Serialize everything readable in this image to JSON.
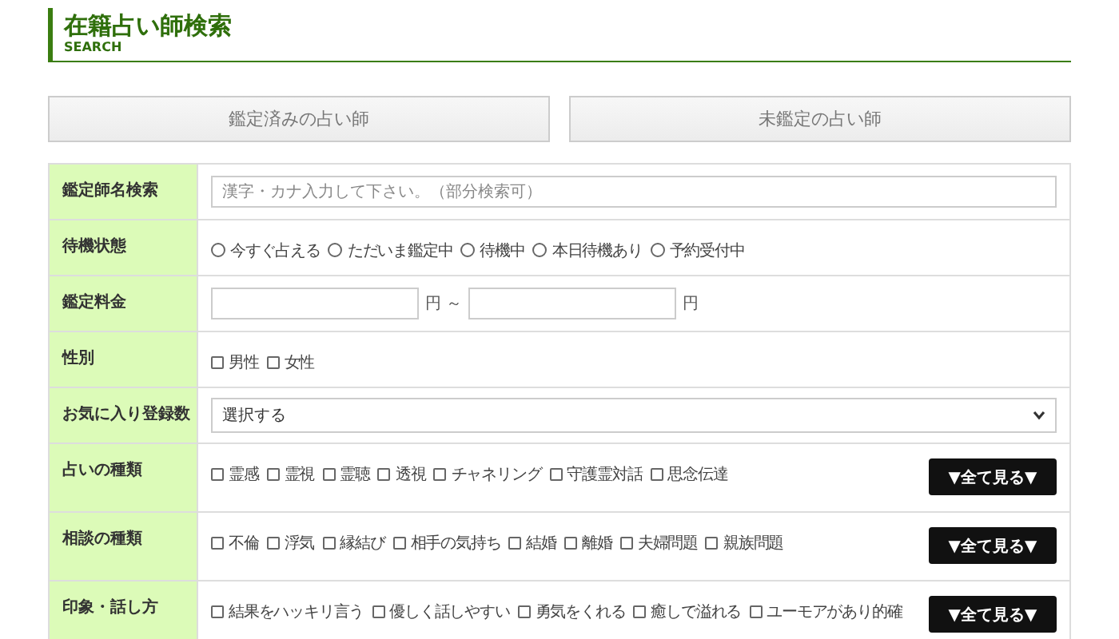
{
  "header": {
    "title": "在籍占い師検索",
    "subtitle": "SEARCH"
  },
  "buttons": [
    "鑑定済みの占い師",
    "未鑑定の占い師"
  ],
  "rows": [
    {
      "kind": "text",
      "label": "鑑定師名検索",
      "placeholder": "漢字・カナ入力して下さい。（部分検索可）"
    },
    {
      "kind": "radio",
      "label": "待機状態",
      "options": [
        {
          "label": "今すぐ占える",
          "selected": false
        },
        {
          "label": "ただいま鑑定中",
          "selected": false
        },
        {
          "label": "待機中",
          "selected": false
        },
        {
          "label": "本日待機あり",
          "selected": false
        },
        {
          "label": "予約受付中",
          "selected": false
        }
      ]
    },
    {
      "kind": "range",
      "label": "鑑定料金",
      "unit_from": "円 ～",
      "unit_to": "円"
    },
    {
      "kind": "checkbox",
      "label": "性別",
      "options": [
        {
          "label": "男性",
          "checked": false
        },
        {
          "label": "女性",
          "checked": false
        }
      ]
    },
    {
      "kind": "select",
      "label": "お気に入り登録数",
      "value": "選択する"
    },
    {
      "kind": "checkbox",
      "label": "占いの種類",
      "more_button": "▼全て見る▼",
      "options": [
        {
          "label": "霊感",
          "checked": false
        },
        {
          "label": "霊視",
          "checked": false
        },
        {
          "label": "霊聴",
          "checked": false
        },
        {
          "label": "透視",
          "checked": false
        },
        {
          "label": "チャネリング",
          "checked": false
        },
        {
          "label": "守護霊対話",
          "checked": false
        },
        {
          "label": "思念伝達",
          "checked": false
        }
      ]
    },
    {
      "kind": "checkbox",
      "label": "相談の種類",
      "more_button": "▼全て見る▼",
      "options": [
        {
          "label": "不倫",
          "checked": false
        },
        {
          "label": "浮気",
          "checked": false
        },
        {
          "label": "縁結び",
          "checked": false
        },
        {
          "label": "相手の気持ち",
          "checked": false
        },
        {
          "label": "結婚",
          "checked": false
        },
        {
          "label": "離婚",
          "checked": false
        },
        {
          "label": "夫婦問題",
          "checked": false
        },
        {
          "label": "親族問題",
          "checked": false
        }
      ]
    },
    {
      "kind": "checkbox",
      "label": "印象・話し方",
      "more_button": "▼全て見る▼",
      "options": [
        {
          "label": "結果をハッキリ言う",
          "checked": false
        },
        {
          "label": "優しく話しやすい",
          "checked": false
        },
        {
          "label": "勇気をくれる",
          "checked": false
        },
        {
          "label": "癒しで溢れる",
          "checked": false
        },
        {
          "label": "ユーモアがあり的確",
          "checked": false
        }
      ]
    }
  ]
}
